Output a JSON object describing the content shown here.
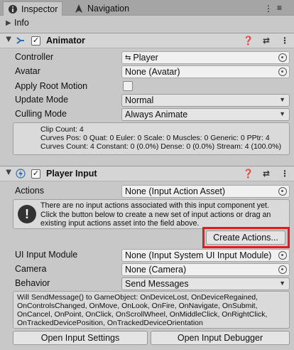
{
  "tabs": [
    {
      "label": "Inspector",
      "icon": "info-icon"
    },
    {
      "label": "Navigation",
      "icon": "navigation-icon"
    }
  ],
  "info_row": {
    "label": "Info"
  },
  "animator": {
    "title": "Animator",
    "properties": {
      "controller": {
        "label": "Controller",
        "value": "Player"
      },
      "avatar": {
        "label": "Avatar",
        "value": "None (Avatar)"
      },
      "apply_root_motion": {
        "label": "Apply Root Motion"
      },
      "update_mode": {
        "label": "Update Mode",
        "value": "Normal"
      },
      "culling_mode": {
        "label": "Culling Mode",
        "value": "Always Animate"
      }
    },
    "stats": [
      "Clip Count: 4",
      "Curves Pos: 0 Quat: 0 Euler: 0 Scale: 0 Muscles: 0 Generic: 0 PPtr: 4",
      "Curves Count: 4 Constant: 0 (0.0%) Dense: 0 (0.0%) Stream: 4 (100.0%)"
    ]
  },
  "player_input": {
    "title": "Player Input",
    "actions": {
      "label": "Actions",
      "value": "None (Input Action Asset)"
    },
    "warning": [
      "There are no input actions associated with this input component yet.",
      "Click the button below to create a new set of input actions or drag an",
      "existing input actions asset into the field above."
    ],
    "create_actions_label": "Create Actions...",
    "ui_input_module": {
      "label": "UI Input Module",
      "value": "None (Input System UI Input Module)"
    },
    "camera": {
      "label": "Camera",
      "value": "None (Camera)"
    },
    "behavior": {
      "label": "Behavior",
      "value": "Send Messages"
    },
    "behavior_info": [
      "Will SendMessage() to GameObject: OnDeviceLost, OnDeviceRegained,",
      "OnControlsChanged, OnMove, OnLook, OnFire, OnNavigate, OnSubmit,",
      "OnCancel, OnPoint, OnClick, OnScrollWheel, OnMiddleClick, OnRightClick,",
      "OnTrackedDevicePosition, OnTrackedDeviceOrientation"
    ],
    "open_settings_label": "Open Input Settings",
    "open_debugger_label": "Open Input Debugger"
  },
  "colors": {
    "highlight": "#e31b1b",
    "panel": "#c8c8c8"
  }
}
